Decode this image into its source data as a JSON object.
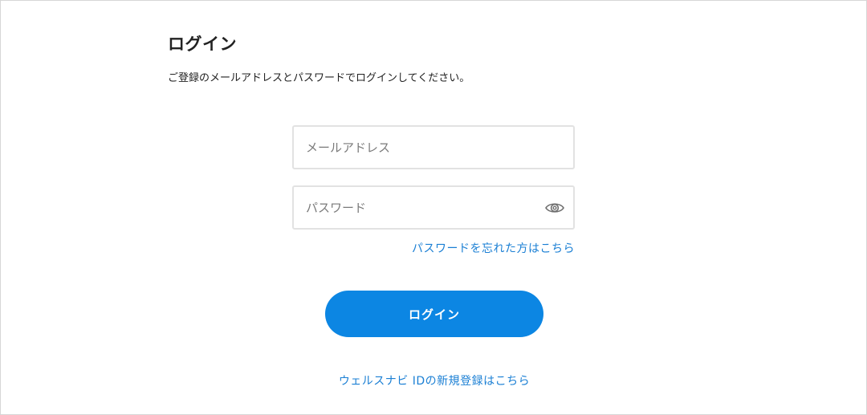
{
  "login": {
    "title": "ログイン",
    "subtitle": "ご登録のメールアドレスとパスワードでログインしてください。",
    "email_placeholder": "メールアドレス",
    "email_value": "",
    "password_placeholder": "パスワード",
    "password_value": "",
    "forgot_password_link": "パスワードを忘れた方はこちら",
    "submit_label": "ログイン",
    "register_link": "ウェルスナビ IDの新規登録はこちら"
  },
  "icons": {
    "password_toggle": "eye-icon"
  },
  "colors": {
    "accent": "#0c86e3",
    "link": "#1a7fd4",
    "border": "#e2e2e2",
    "text": "#222222",
    "placeholder": "#7a7a7a"
  }
}
